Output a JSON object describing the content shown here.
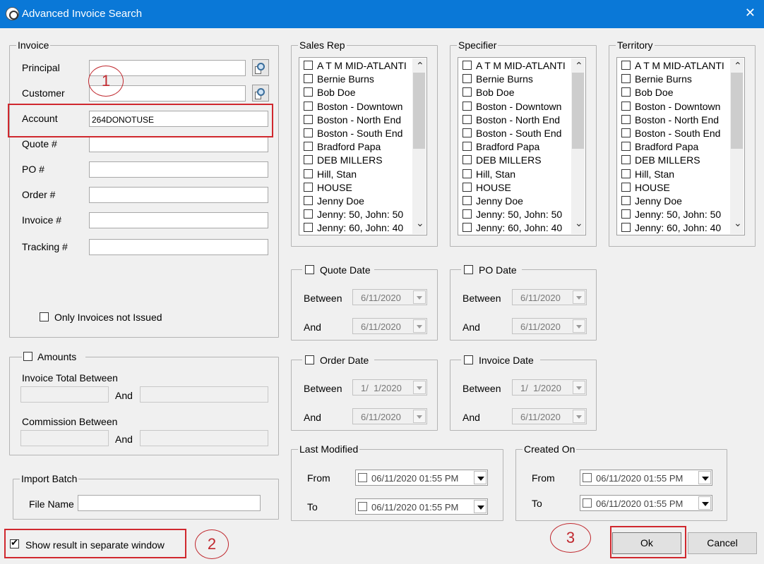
{
  "window": {
    "title": "Advanced Invoice Search",
    "close_glyph": "✕",
    "icon": "app-compass-icon"
  },
  "invoice": {
    "group_title": "Invoice",
    "principal_label": "Principal",
    "customer_label": "Customer",
    "account_label": "Account",
    "account_value": "264DONOTUSE",
    "quote_label": "Quote #",
    "po_label": "PO #",
    "order_label": "Order #",
    "invoice_label": "Invoice #",
    "tracking_label": "Tracking #",
    "only_not_issued_label": "Only Invoices not Issued"
  },
  "amounts": {
    "group_title": "Amounts",
    "invoice_total_label": "Invoice Total Between",
    "and_label": "And",
    "commission_label": "Commission Between"
  },
  "import_batch": {
    "group_title": "Import Batch",
    "file_name_label": "File Name"
  },
  "show_result_label": "Show result in separate window",
  "lists": {
    "sales_rep_title": "Sales Rep",
    "specifier_title": "Specifier",
    "territory_title": "Territory",
    "items": [
      "A T M MID-ATLANTI",
      "Bernie Burns",
      "Bob Doe",
      "Boston - Downtown",
      "Boston - North End",
      "Boston - South End",
      "Bradford Papa",
      "DEB MILLERS",
      "Hill, Stan",
      "HOUSE",
      "Jenny Doe",
      "Jenny: 50, John: 50",
      "Jenny: 60, John: 40"
    ]
  },
  "dates": {
    "between_label": "Between",
    "and_label": "And",
    "quote": {
      "title": "Quote Date",
      "between": "6/11/2020",
      "and": "6/11/2020"
    },
    "po": {
      "title": "PO Date",
      "between": "6/11/2020",
      "and": "6/11/2020"
    },
    "order": {
      "title": "Order Date",
      "between": "1/  1/2020",
      "and": "6/11/2020"
    },
    "invoice": {
      "title": "Invoice Date",
      "between": "1/  1/2020",
      "and": "6/11/2020"
    }
  },
  "last_modified": {
    "title": "Last Modified",
    "from_label": "From",
    "to_label": "To",
    "from": "06/11/2020 01:55 PM",
    "to": "06/11/2020 01:55 PM"
  },
  "created_on": {
    "title": "Created On",
    "from_label": "From",
    "to_label": "To",
    "from": "06/11/2020 01:55 PM",
    "to": "06/11/2020 01:55 PM"
  },
  "buttons": {
    "ok": "Ok",
    "cancel": "Cancel"
  },
  "annotations": {
    "one": "1",
    "two": "2",
    "three": "3",
    "color": "#d0282e"
  }
}
